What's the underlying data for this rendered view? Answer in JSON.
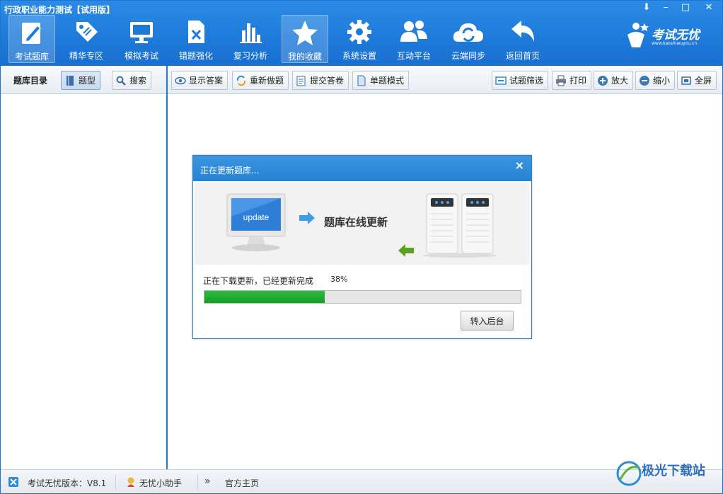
{
  "window": {
    "title": "行政职业能力测试【试用版】",
    "controls": [
      "⬇",
      "–",
      "□",
      "✕"
    ]
  },
  "toolbar": {
    "items": [
      {
        "label": "考试题库",
        "icon": "pen-paper-icon",
        "active": true
      },
      {
        "label": "精华专区",
        "icon": "tag-icon",
        "active": false
      },
      {
        "label": "模拟考试",
        "icon": "monitor-icon",
        "active": false
      },
      {
        "label": "错题强化",
        "icon": "error-doc-icon",
        "active": false
      },
      {
        "label": "复习分析",
        "icon": "bar-chart-icon",
        "active": false
      },
      {
        "label": "我的收藏",
        "icon": "star-icon",
        "active": true
      },
      {
        "label": "系统设置",
        "icon": "gear-icon",
        "active": false
      },
      {
        "label": "互动平台",
        "icon": "users-icon",
        "active": false
      },
      {
        "label": "云端同步",
        "icon": "cloud-sync-icon",
        "active": false
      },
      {
        "label": "返回首页",
        "icon": "back-arrow-icon",
        "active": false
      }
    ]
  },
  "logo": {
    "text": "考试无忧",
    "sub": "www.kaoshiwuyou.cn"
  },
  "leftpane": {
    "title": "题库目录",
    "btn_type": "题型",
    "btn_search": "搜索"
  },
  "actions": {
    "show_answer": "显示答案",
    "redo": "重新做题",
    "submit": "提交答卷",
    "single_mode": "单题模式",
    "filter": "试题筛选",
    "print": "打印",
    "zoom_in": "放大",
    "zoom_out": "缩小",
    "fullscreen": "全屏"
  },
  "dialog": {
    "title": "正在更新题库...",
    "screen_text": "update",
    "banner_text": "题库在线更新",
    "status": "正在下载更新，已经更新完成",
    "percent_text": "38%",
    "progress": 0.38,
    "button": "转入后台"
  },
  "statusbar": {
    "version": "考试无忧版本：V8.1",
    "assistant": "无忧小助手",
    "homepage": "官方主页"
  },
  "watermark": {
    "text": "极光下载站"
  },
  "colors": {
    "accent": "#1e7ad9",
    "progress": "#1fae33"
  }
}
